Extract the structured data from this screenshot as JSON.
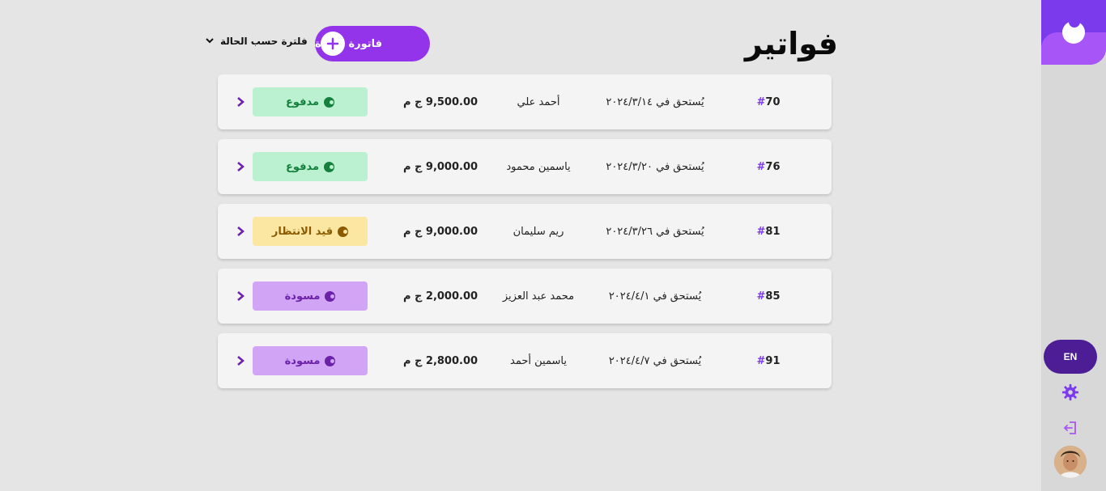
{
  "header": {
    "title": "فواتير",
    "new_invoice_label": "فاتورة جديدة",
    "filter_label": "فلترة حسب الحالة"
  },
  "sidebar": {
    "lang_label": "EN"
  },
  "invoices": [
    {
      "hash": "#",
      "id": "70",
      "due": "يُستحق في ٢٠٢٤/٣/١٤",
      "client": "أحمد علي",
      "amount": "9,500.00 ج م",
      "status": "مدفوع",
      "status_kind": "paid"
    },
    {
      "hash": "#",
      "id": "76",
      "due": "يُستحق في ٢٠٢٤/٣/٢٠",
      "client": "ياسمين محمود",
      "amount": "9,000.00 ج م",
      "status": "مدفوع",
      "status_kind": "paid"
    },
    {
      "hash": "#",
      "id": "81",
      "due": "يُستحق في ٢٠٢٤/٣/٢٦",
      "client": "ريم سليمان",
      "amount": "9,000.00 ج م",
      "status": "قيد الانتظار",
      "status_kind": "pending"
    },
    {
      "hash": "#",
      "id": "85",
      "due": "يُستحق في ٢٠٢٤/٤/١",
      "client": "محمد عبد العزيز",
      "amount": "2,000.00 ج م",
      "status": "مسودة",
      "status_kind": "draft"
    },
    {
      "hash": "#",
      "id": "91",
      "due": "يُستحق في ٢٠٢٤/٤/٧",
      "client": "ياسمين أحمد",
      "amount": "2,800.00 ج م",
      "status": "مسودة",
      "status_kind": "draft"
    }
  ],
  "colors": {
    "accent": "#9333ea",
    "paid": "#15803d",
    "pending": "#8a5a00",
    "draft": "#6b21a8"
  }
}
